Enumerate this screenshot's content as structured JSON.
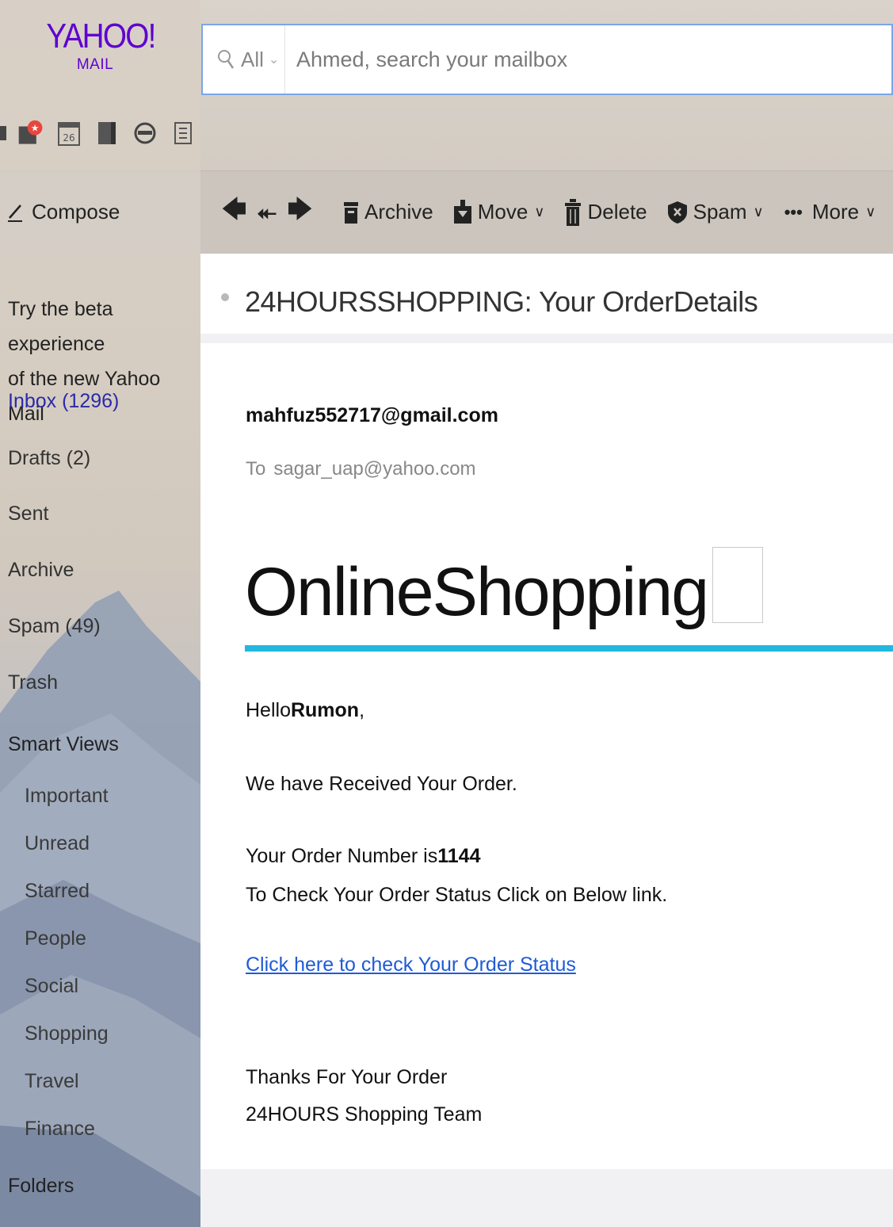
{
  "logo": {
    "brand": "YAHOO!",
    "product": "MAIL"
  },
  "search": {
    "scope": "All",
    "placeholder": "Ahmed, search your mailbox"
  },
  "app_icons": [
    "mail-icon",
    "contacts-icon",
    "calendar-icon",
    "notepad-icon",
    "messenger-icon",
    "news-icon"
  ],
  "calendar_day": "26",
  "compose": {
    "label": "Compose"
  },
  "toolbar": {
    "archive": "Archive",
    "move": "Move",
    "delete": "Delete",
    "spam": "Spam",
    "more": "More"
  },
  "sidebar": {
    "beta_line1": "Try the beta experience",
    "beta_line2": "of the new Yahoo Mail",
    "folders": [
      {
        "label": "Inbox (1296)"
      },
      {
        "label": "Drafts (2)"
      },
      {
        "label": "Sent"
      },
      {
        "label": "Archive"
      },
      {
        "label": "Spam (49)"
      },
      {
        "label": "Trash"
      }
    ],
    "smart_views_heading": "Smart Views",
    "smart_views": [
      "Important",
      "Unread",
      "Starred",
      "People",
      "Social",
      "Shopping",
      "Travel",
      "Finance"
    ],
    "folders_heading": "Folders"
  },
  "message": {
    "subject": "24HOURSSHOPPING: Your OrderDetails",
    "from": "mahfuz552717@gmail.com",
    "to_label": "To",
    "to_address": "sagar_uap@yahoo.com",
    "hero_title": "OnlineShopping",
    "greeting_prefix": "Hello",
    "greeting_name": "Rumon",
    "greeting_suffix": ",",
    "received": "We have Received Your Order.",
    "order_prefix": "Your Order Number is",
    "order_number": "1144",
    "check_text": "To Check Your Order Status Click on Below link.",
    "link_text": "Click here to check Your Order Status",
    "thanks": "Thanks For Your Order",
    "team": "24HOURS Shopping Team"
  },
  "colors": {
    "brand": "#5f01d1",
    "accent_rule": "#22b8df",
    "link": "#1f5bd6",
    "active_folder": "#2a2aa8"
  }
}
